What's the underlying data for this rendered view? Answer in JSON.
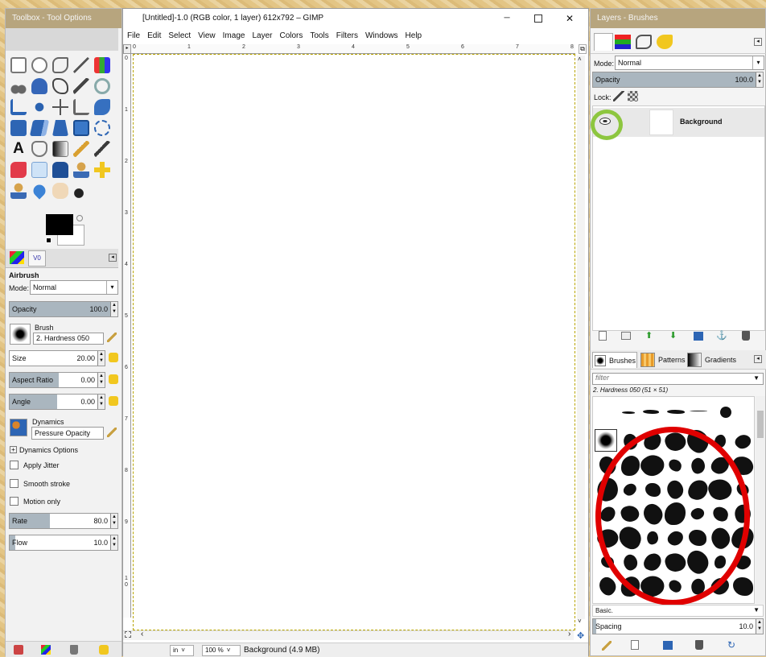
{
  "toolbox": {
    "title": "Toolbox - Tool Options",
    "tool_name": "Airbrush",
    "mode_label": "Mode:",
    "mode_value": "Normal",
    "opacity_label": "Opacity",
    "opacity_value": "100.0",
    "opacity_fraction": 1.0,
    "brush_label": "Brush",
    "brush_value": "2. Hardness 050",
    "size_label": "Size",
    "size_value": "20.00",
    "aspect_label": "Aspect Ratio",
    "aspect_value": "0.00",
    "angle_label": "Angle",
    "angle_value": "0.00",
    "dynamics_label": "Dynamics",
    "dynamics_value": "Pressure Opacity",
    "dynamics_options": "Dynamics Options",
    "apply_jitter": "Apply Jitter",
    "smooth_stroke": "Smooth stroke",
    "motion_only": "Motion only",
    "rate_label": "Rate",
    "rate_value": "80.0",
    "rate_fraction": 0.8,
    "flow_label": "Flow",
    "flow_value": "10.0",
    "flow_fraction": 0.1,
    "tab_icon_label": "V0"
  },
  "canvas_window": {
    "title": "[Untitled]-1.0 (RGB color, 1 layer) 612x792 – GIMP",
    "menu": [
      "File",
      "Edit",
      "Select",
      "View",
      "Image",
      "Layer",
      "Colors",
      "Tools",
      "Filters",
      "Windows",
      "Help"
    ],
    "ruler_top": [
      "0",
      "1",
      "2",
      "3",
      "4",
      "5",
      "6",
      "7",
      "8"
    ],
    "ruler_left": [
      "0",
      "1",
      "2",
      "3",
      "4",
      "5",
      "6",
      "7",
      "8",
      "9",
      "1",
      "0"
    ],
    "unit": "in",
    "zoom": "100 %",
    "status": "Background (4.9 MB)"
  },
  "layers": {
    "title": "Layers - Brushes",
    "mode_label": "Mode:",
    "mode_value": "Normal",
    "opacity_label": "Opacity",
    "opacity_value": "100.0",
    "lock_label": "Lock:",
    "layer_name": "Background"
  },
  "brushes": {
    "tab_brushes": "Brushes",
    "tab_patterns": "Patterns",
    "tab_gradients": "Gradients",
    "filter_placeholder": "filter",
    "selected": "2. Hardness 050 (51 × 51)",
    "tag": "Basic.",
    "spacing_label": "Spacing",
    "spacing_value": "10.0"
  },
  "colors": {
    "highlight_green": "#8dc63f",
    "highlight_red": "#e00000",
    "spin_fill": "#aab6bf"
  }
}
